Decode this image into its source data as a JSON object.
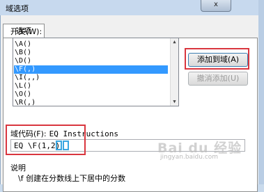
{
  "window": {
    "title": "域选项",
    "close_label": "x"
  },
  "tabs": [
    {
      "label": "选项"
    }
  ],
  "switches": {
    "label": "开关(W):",
    "items": [
      "\\A()",
      "\\B()",
      "\\D()",
      "\\F(,)",
      "\\I(,,)",
      "\\L()",
      "\\O()",
      "\\R(,)"
    ],
    "selected_index": 3
  },
  "buttons": {
    "add": "添加到域(A)",
    "undo_add": "撤消添加(U)"
  },
  "field_code": {
    "label": "域代码(F):",
    "hint": "EQ Instructions",
    "value": "EQ \\F(1,2)"
  },
  "description": {
    "label": "说明",
    "text": "\\f 创建在分数线上下居中的分数"
  },
  "watermark": {
    "brand": "Bai du 经验",
    "url": "jingyan.baidu.com"
  },
  "colors": {
    "selection": "#3399ff",
    "highlight_box": "#d9363e",
    "paren_box": "#3aa6e0"
  }
}
